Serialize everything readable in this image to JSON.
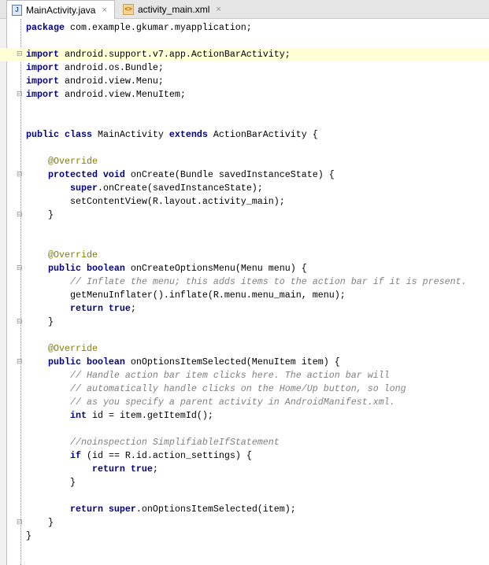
{
  "tabs": [
    {
      "label": "MainActivity.java",
      "icon": "java-file-icon",
      "active": true
    },
    {
      "label": "activity_main.xml",
      "icon": "xml-file-icon",
      "active": false
    }
  ],
  "close_glyph": "×",
  "highlight_line": 3,
  "fold_open": [
    3,
    12,
    19,
    26
  ],
  "fold_close": [
    6,
    15,
    23,
    38
  ],
  "lines": [
    [
      [
        "kw",
        "package"
      ],
      [
        "t",
        " com.example.gkumar.myapplication;"
      ]
    ],
    [],
    [
      [
        "kw",
        "import"
      ],
      [
        "t",
        " android.support.v7.app.ActionBarActivity;"
      ]
    ],
    [
      [
        "kw",
        "import"
      ],
      [
        "t",
        " android.os.Bundle;"
      ]
    ],
    [
      [
        "kw",
        "import"
      ],
      [
        "t",
        " android.view.Menu;"
      ]
    ],
    [
      [
        "kw",
        "import"
      ],
      [
        "t",
        " android.view.MenuItem;"
      ]
    ],
    [],
    [],
    [
      [
        "kw",
        "public class"
      ],
      [
        "t",
        " MainActivity "
      ],
      [
        "kw",
        "extends"
      ],
      [
        "t",
        " ActionBarActivity {"
      ]
    ],
    [],
    [
      [
        "t",
        "    "
      ],
      [
        "an",
        "@Override"
      ]
    ],
    [
      [
        "t",
        "    "
      ],
      [
        "kw",
        "protected void"
      ],
      [
        "t",
        " onCreate(Bundle savedInstanceState) {"
      ]
    ],
    [
      [
        "t",
        "        "
      ],
      [
        "kw",
        "super"
      ],
      [
        "t",
        ".onCreate(savedInstanceState);"
      ]
    ],
    [
      [
        "t",
        "        setContentView(R.layout.activity_main);"
      ]
    ],
    [
      [
        "t",
        "    }"
      ]
    ],
    [],
    [],
    [
      [
        "t",
        "    "
      ],
      [
        "an",
        "@Override"
      ]
    ],
    [
      [
        "t",
        "    "
      ],
      [
        "kw",
        "public boolean"
      ],
      [
        "t",
        " onCreateOptionsMenu(Menu menu) {"
      ]
    ],
    [
      [
        "t",
        "        "
      ],
      [
        "cm",
        "// Inflate the menu; this adds items to the action bar if it is present."
      ]
    ],
    [
      [
        "t",
        "        getMenuInflater().inflate(R.menu.menu_main, menu);"
      ]
    ],
    [
      [
        "t",
        "        "
      ],
      [
        "kw",
        "return true"
      ],
      [
        "t",
        ";"
      ]
    ],
    [
      [
        "t",
        "    }"
      ]
    ],
    [],
    [
      [
        "t",
        "    "
      ],
      [
        "an",
        "@Override"
      ]
    ],
    [
      [
        "t",
        "    "
      ],
      [
        "kw",
        "public boolean"
      ],
      [
        "t",
        " onOptionsItemSelected(MenuItem item) {"
      ]
    ],
    [
      [
        "t",
        "        "
      ],
      [
        "cm",
        "// Handle action bar item clicks here. The action bar will"
      ]
    ],
    [
      [
        "t",
        "        "
      ],
      [
        "cm",
        "// automatically handle clicks on the Home/Up button, so long"
      ]
    ],
    [
      [
        "t",
        "        "
      ],
      [
        "cm",
        "// as you specify a parent activity in AndroidManifest.xml."
      ]
    ],
    [
      [
        "t",
        "        "
      ],
      [
        "kw",
        "int"
      ],
      [
        "t",
        " id = item.getItemId();"
      ]
    ],
    [],
    [
      [
        "t",
        "        "
      ],
      [
        "cm",
        "//noinspection SimplifiableIfStatement"
      ]
    ],
    [
      [
        "t",
        "        "
      ],
      [
        "kw",
        "if"
      ],
      [
        "t",
        " (id == R.id.action_settings) {"
      ]
    ],
    [
      [
        "t",
        "            "
      ],
      [
        "kw",
        "return true"
      ],
      [
        "t",
        ";"
      ]
    ],
    [
      [
        "t",
        "        }"
      ]
    ],
    [],
    [
      [
        "t",
        "        "
      ],
      [
        "kw",
        "return super"
      ],
      [
        "t",
        ".onOptionsItemSelected(item);"
      ]
    ],
    [
      [
        "t",
        "    }"
      ]
    ],
    [
      [
        "t",
        "}"
      ]
    ]
  ]
}
